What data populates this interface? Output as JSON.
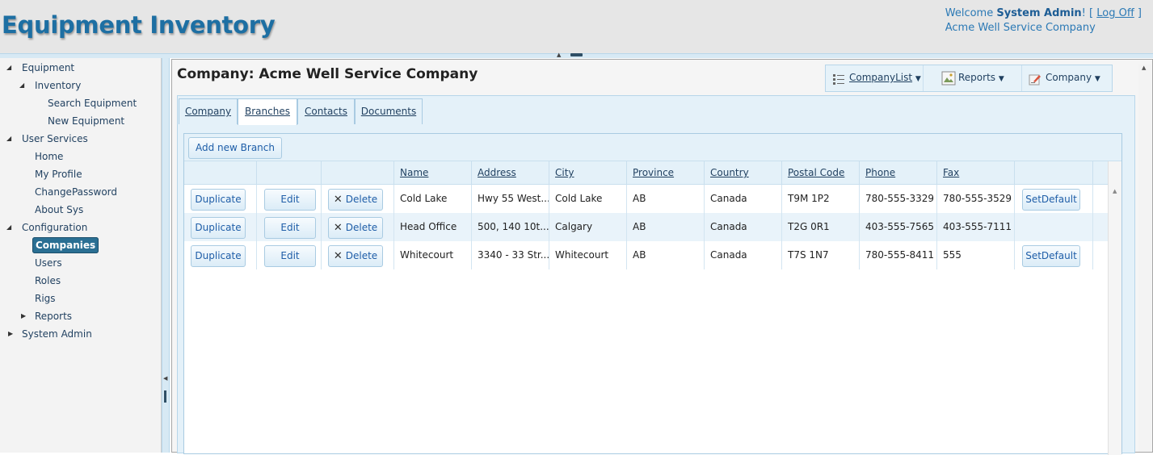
{
  "header": {
    "app_title": "Equipment Inventory",
    "welcome_prefix": "Welcome ",
    "user_name": "System Admin",
    "welcome_suffix": "! [ ",
    "logoff_label": "Log Off",
    "logoff_close": " ]",
    "company_name": "Acme Well Service Company"
  },
  "sidebar": {
    "items": [
      {
        "label": "Equipment",
        "toggle": "◢"
      },
      {
        "label": "Inventory",
        "toggle": "◢"
      },
      {
        "label": "Search Equipment"
      },
      {
        "label": "New Equipment"
      },
      {
        "label": "User Services",
        "toggle": "◢"
      },
      {
        "label": "Home"
      },
      {
        "label": "My Profile"
      },
      {
        "label": "ChangePassword"
      },
      {
        "label": "About Sys"
      },
      {
        "label": "Configuration",
        "toggle": "◢"
      },
      {
        "label": "Companies",
        "selected": true
      },
      {
        "label": "Users"
      },
      {
        "label": "Roles"
      },
      {
        "label": "Rigs"
      },
      {
        "label": "Reports",
        "toggle": "▶"
      },
      {
        "label": "System Admin",
        "toggle": "▶"
      }
    ]
  },
  "main": {
    "page_title": "Company: Acme Well Service Company",
    "toolbar": {
      "company_list": "CompanyList",
      "reports": "Reports",
      "company": "Company",
      "dropdown_glyph": "▼"
    },
    "tabs": [
      {
        "label": "Company"
      },
      {
        "label": "Branches",
        "active": true
      },
      {
        "label": "Contacts"
      },
      {
        "label": "Documents"
      }
    ]
  },
  "grid": {
    "add_label": "Add new Branch",
    "columns": [
      "Name",
      "Address",
      "City",
      "Province",
      "Country",
      "Postal Code",
      "Phone",
      "Fax"
    ],
    "duplicate_label": "Duplicate",
    "edit_label": "Edit",
    "delete_label": "Delete",
    "setdefault_label": "SetDefault",
    "rows": [
      {
        "name": "Cold Lake",
        "address": "Hwy 55 West...",
        "city": "Cold Lake",
        "province": "AB",
        "country": "Canada",
        "postal": "T9M 1P2",
        "phone": "780-555-3329",
        "fax": "780-555-3529",
        "setdefault": true
      },
      {
        "name": "Head Office",
        "address": "500, 140 10t...",
        "city": "Calgary",
        "province": "AB",
        "country": "Canada",
        "postal": "T2G 0R1",
        "phone": "403-555-7565",
        "fax": "403-555-7111",
        "setdefault": false
      },
      {
        "name": "Whitecourt",
        "address": "3340 - 33 Str...",
        "city": "Whitecourt",
        "province": "AB",
        "country": "Canada",
        "postal": "T7S 1N7",
        "phone": "780-555-8411",
        "fax": "555",
        "setdefault": true
      }
    ]
  },
  "colors": {
    "brand_blue": "#1d6fa3",
    "selected_nav": "#2a6f93",
    "panel_blue": "#e4f1f9"
  }
}
